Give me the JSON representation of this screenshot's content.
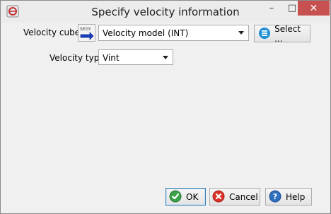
{
  "window": {
    "title": "Specify velocity information",
    "icons": {
      "app": "app-icon",
      "minimize": "minimize-icon",
      "maximize": "maximize-icon",
      "close": "close-icon"
    },
    "controls": {
      "minimize": "–",
      "maximize": "□",
      "close": "✕"
    }
  },
  "form": {
    "velocity_cube_label": "Velocity cube",
    "velocity_cube_icon": "segy-cube-icon",
    "velocity_cube_value": "Velocity model (INT)",
    "select_button_label": "Select ...",
    "select_button_icon": "list-icon",
    "velocity_type_label": "Velocity type",
    "velocity_type_value": "Vint"
  },
  "footer": {
    "ok_label": "OK",
    "ok_icon": "check-icon",
    "cancel_label": "Cancel",
    "cancel_icon": "cancel-icon",
    "help_label": "Help",
    "help_icon": "help-icon"
  },
  "colors": {
    "close_button": "#c75050",
    "ok_icon": "#3aa04a",
    "cancel_icon": "#d9342b",
    "help_icon": "#2f6fc0",
    "select_icon": "#1e8fd6"
  }
}
